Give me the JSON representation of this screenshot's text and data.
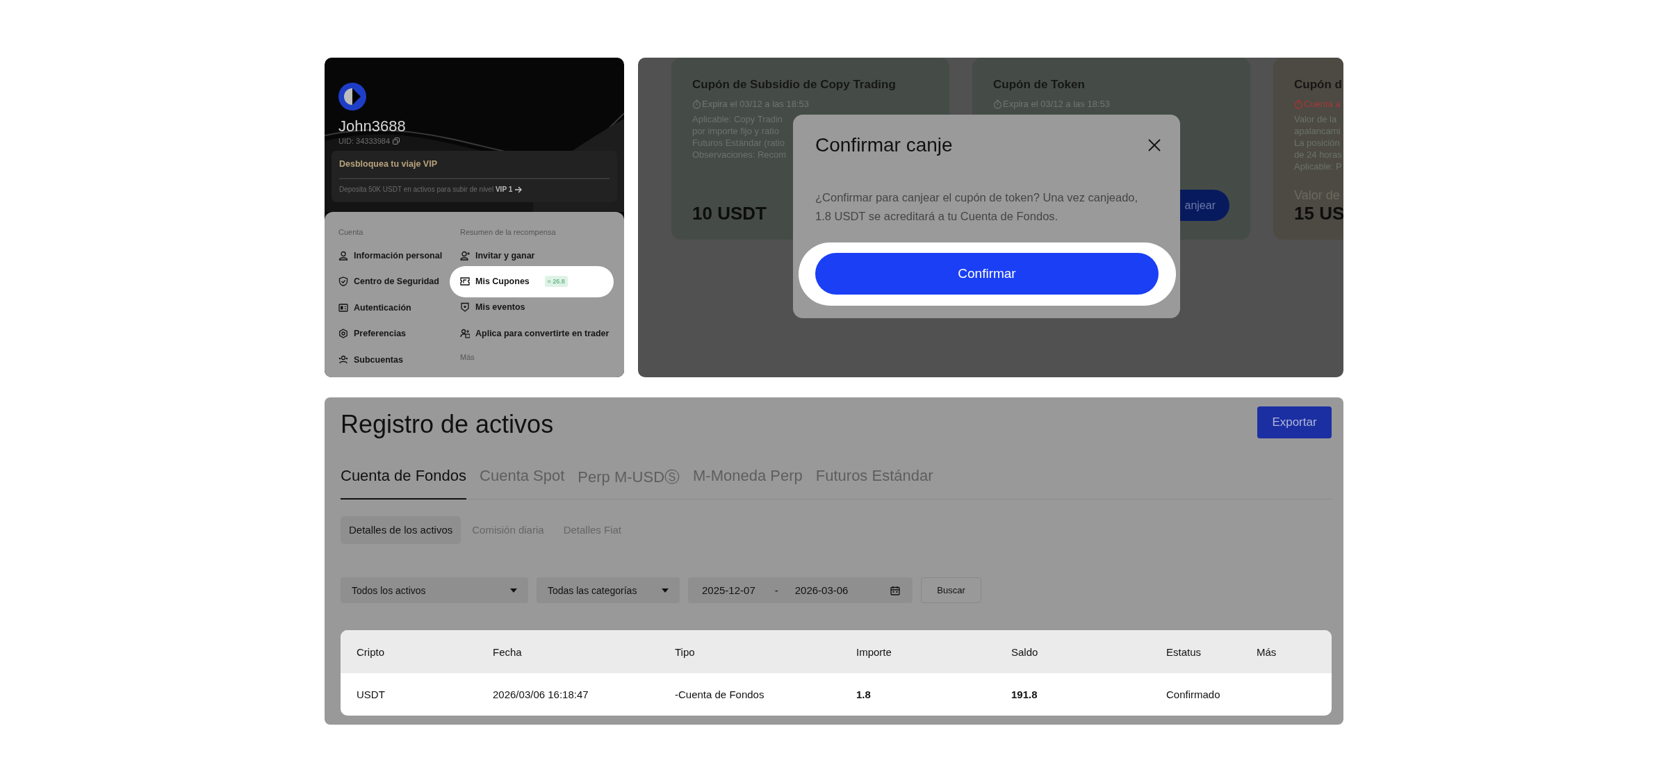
{
  "profile": {
    "username": "John3688",
    "uid": "UID: 34333984",
    "vip": {
      "title": "Desbloquea tu viaje VIP",
      "text": "Deposita 50K USDT en activos para subir de nivel **VIP 1**"
    }
  },
  "menu": {
    "columns": [
      {
        "heading": "Cuenta",
        "items": [
          {
            "label": "Información personal",
            "selected": false
          },
          {
            "label": "Centro de Seguridad",
            "selected": false
          },
          {
            "label": "Autenticación",
            "selected": false
          },
          {
            "label": "Preferencias",
            "selected": false
          },
          {
            "label": "Subcuentas",
            "selected": false
          }
        ]
      },
      {
        "heading": "Resumen de la recompensa",
        "items": [
          {
            "label": "Invitar y ganar",
            "selected": false
          },
          {
            "label": "Mis Cupones",
            "selected": true,
            "badge": "≈ 26.8"
          },
          {
            "label": "Mis eventos",
            "selected": false
          },
          {
            "label": "Aplica para convertirte en trader",
            "selected": false
          }
        ],
        "footer": "Más"
      }
    ]
  },
  "coupons": [
    {
      "title": "Cupón de Subsidio de Copy Trading",
      "color": "#454c47",
      "expiry": "Expira el 03/12 a las 18:53",
      "urgent": false,
      "lines": [
        "Aplicable: Copy Tradin",
        "por importe fijo y ratio",
        "Futuros Estándar (ratio",
        "Observaciones: Recom"
      ],
      "amount": "10 USDT"
    },
    {
      "title": "Cupón de Token",
      "color": "#454c47",
      "expiry": "Expira el 03/12 a las 18:53",
      "urgent": false,
      "button": "anjear"
    },
    {
      "title": "Cupón d",
      "color": "#4c4a42",
      "expiry": "Cuenta a",
      "urgent": true,
      "lines": [
        "Valor de la",
        "apalancami",
        "La posición",
        "de 24 horas",
        "Aplicable: P"
      ],
      "amount_label": "Valor de",
      "amount": "15 US"
    }
  ],
  "dialog": {
    "title": "Confirmar canje",
    "message": "¿Confirmar para canjear el cupón de token? Una vez canjeado, 1.8 USDT se acreditará a tu Cuenta de Fondos.",
    "confirm": "Confirmar"
  },
  "asset_record": {
    "title": "Registro de activos",
    "export": "Exportar",
    "tabs": [
      {
        "label": "Cuenta de Fondos",
        "selected": true
      },
      {
        "label": "Cuenta Spot",
        "selected": false
      },
      {
        "label": "Perp M-USDⓈ",
        "selected": false
      },
      {
        "label": "M-Moneda Perp",
        "selected": false
      },
      {
        "label": "Futuros Estándar",
        "selected": false
      }
    ],
    "subtabs": [
      {
        "label": "Detalles de los activos",
        "selected": true
      },
      {
        "label": "Comisión diaria",
        "selected": false
      },
      {
        "label": "Detalles Fiat",
        "selected": false
      }
    ],
    "filters": {
      "asset": "Todos los activos",
      "category": "Todas las categorías",
      "date_from": "2025-12-07",
      "date_separator": "-",
      "date_to": "2026-03-06",
      "search": "Buscar"
    },
    "table": {
      "columns": [
        "Cripto",
        "Fecha",
        "Tipo",
        "Importe",
        "Saldo",
        "Estatus",
        "Más"
      ],
      "rows": [
        [
          {
            "text": "USDT",
            "bold": false
          },
          {
            "text": "2026/03/06 16:18:47",
            "bold": false
          },
          {
            "text": "-Cuenta de Fondos",
            "bold": false
          },
          {
            "text": "1.8",
            "bold": true
          },
          {
            "text": "191.8",
            "bold": true
          },
          {
            "text": "Confirmado",
            "bold": false
          }
        ]
      ]
    }
  }
}
